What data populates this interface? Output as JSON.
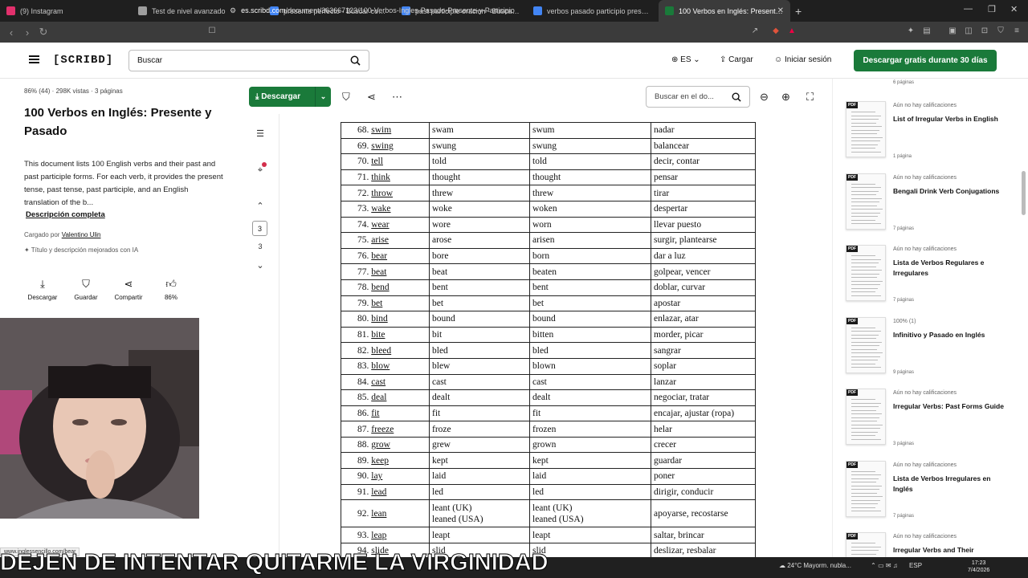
{
  "browser": {
    "tabs": [
      {
        "title": "(9) Instagram",
        "color": "#e1306c"
      },
      {
        "title": "Test de nivel avanzado",
        "color": "#9e9e9e"
      },
      {
        "title": "presente perfecto - Buscar con Goog",
        "color": "#4285f4"
      },
      {
        "title": "past participle oracion - Buscar con G",
        "color": "#4285f4"
      },
      {
        "title": "verbos pasado participio presente q",
        "color": "#4285f4"
      },
      {
        "title": "100 Verbos en Inglés: Presente y",
        "color": "#1a7a3a"
      }
    ],
    "url_domain": "es.scribd.com",
    "url_path": "/document/363667123/100-Verbos-Ingles-Pasado-Presente-y-Participio"
  },
  "header": {
    "logo": "[SCRIBD]",
    "search_placeholder": "Buscar",
    "language": "ES",
    "upload": "Cargar",
    "login": "Iniciar sesión",
    "cta": "Descargar gratis durante 30 días"
  },
  "doc": {
    "stats": "86% (44)  ·  298K vistas  ·  3 páginas",
    "title": "100 Verbos en Inglés: Presente y Pasado",
    "description": "This document lists 100 English verbs and their past and past participle forms. For each verb, it provides the present tense, past tense, past participle, and an English translation of the b...",
    "full_description": "Descripción completa",
    "uploaded_by_label": "Cargado por",
    "uploaded_by": "Valentino Ulin",
    "improved": "Título y descripción mejorados con IA",
    "actions": [
      {
        "icon": "download-icon",
        "label": "Descargar"
      },
      {
        "icon": "bookmark-icon",
        "label": "Guardar"
      },
      {
        "icon": "share-icon",
        "label": "Compartir"
      },
      {
        "icon": "thumbs-up-icon",
        "label": "86%"
      }
    ]
  },
  "toolbar": {
    "download": "Descargar",
    "doc_search_placeholder": "Buscar en el do..."
  },
  "sidenav": {
    "page_current": "3",
    "page_total": "3"
  },
  "verbs": [
    [
      "68.",
      "swim",
      "swam",
      "swum",
      "nadar"
    ],
    [
      "69.",
      "swing",
      "swung",
      "swung",
      "balancear"
    ],
    [
      "70.",
      "tell",
      "told",
      "told",
      "decir, contar"
    ],
    [
      "71.",
      "think",
      "thought",
      "thought",
      "pensar"
    ],
    [
      "72.",
      "throw",
      "threw",
      "threw",
      "tirar"
    ],
    [
      "73.",
      "wake",
      "woke",
      "woken",
      "despertar"
    ],
    [
      "74.",
      "wear",
      "wore",
      "worn",
      "llevar puesto"
    ],
    [
      "75.",
      "arise",
      "arose",
      "arisen",
      "surgir, plantearse"
    ],
    [
      "76.",
      "bear",
      "bore",
      "born",
      "dar a luz"
    ],
    [
      "77.",
      "beat",
      "beat",
      "beaten",
      "golpear, vencer"
    ],
    [
      "78.",
      "bend",
      "bent",
      "bent",
      "doblar, curvar"
    ],
    [
      "79.",
      "bet",
      "bet",
      "bet",
      "apostar"
    ],
    [
      "80.",
      "bind",
      "bound",
      "bound",
      "enlazar, atar"
    ],
    [
      "81.",
      "bite",
      "bit",
      "bitten",
      "morder, picar"
    ],
    [
      "82.",
      "bleed",
      "bled",
      "bled",
      "sangrar"
    ],
    [
      "83.",
      "blow",
      "blew",
      "blown",
      "soplar"
    ],
    [
      "84.",
      "cast",
      "cast",
      "cast",
      "lanzar"
    ],
    [
      "85.",
      "deal",
      "dealt",
      "dealt",
      "negociar, tratar"
    ],
    [
      "86.",
      "fit",
      "fit",
      "fit",
      "encajar, ajustar (ropa)"
    ],
    [
      "87.",
      "freeze",
      "froze",
      "frozen",
      "helar"
    ],
    [
      "88.",
      "grow",
      "grew",
      "grown",
      "crecer"
    ],
    [
      "89.",
      "keep",
      "kept",
      "kept",
      "guardar"
    ],
    [
      "90.",
      "lay",
      "laid",
      "laid",
      "poner"
    ],
    [
      "91.",
      "lead",
      "led",
      "led",
      "dirigir, conducir"
    ],
    [
      "92.",
      "lean",
      "leant (UK)\nleaned (USA)",
      "leant (UK)\nleaned (USA)",
      "apoyarse, recostarse"
    ],
    [
      "93.",
      "leap",
      "leapt",
      "leapt",
      "saltar, brincar"
    ],
    [
      "94.",
      "slide",
      "slid",
      "slid",
      "deslizar, resbalar"
    ]
  ],
  "related": {
    "top_pages": "6 páginas",
    "items": [
      {
        "rating": "Aún no hay calificaciones",
        "title": "List of Irregular Verbs in English",
        "pages": "1 página"
      },
      {
        "rating": "Aún no hay calificaciones",
        "title": "Bengali Drink Verb Conjugations",
        "pages": "7 páginas"
      },
      {
        "rating": "Aún no hay calificaciones",
        "title": "Lista de Verbos Regulares e Irregulares",
        "pages": "7 páginas"
      },
      {
        "rating": "100% (1)",
        "title": "Infinitivo y Pasado en Inglés",
        "pages": "9 páginas"
      },
      {
        "rating": "Aún no hay calificaciones",
        "title": "Irregular Verbs: Past Forms Guide",
        "pages": "3 páginas"
      },
      {
        "rating": "Aún no hay calificaciones",
        "title": "Lista de Verbos Irregulares en Inglés",
        "pages": "7 páginas"
      },
      {
        "rating": "Aún no hay calificaciones",
        "title": "Irregular Verbs and Their",
        "pages": ""
      }
    ]
  },
  "overlay": {
    "link_hint": "www.inglessencillo.com/bear",
    "caption": "DEJEN DE INTENTAR QUITARME LA VIRGINIDAD"
  },
  "taskbar": {
    "weather": "24°C  Mayorm. nubla...",
    "lang": "ESP",
    "time": "17:23",
    "date": "7/4/2026"
  }
}
